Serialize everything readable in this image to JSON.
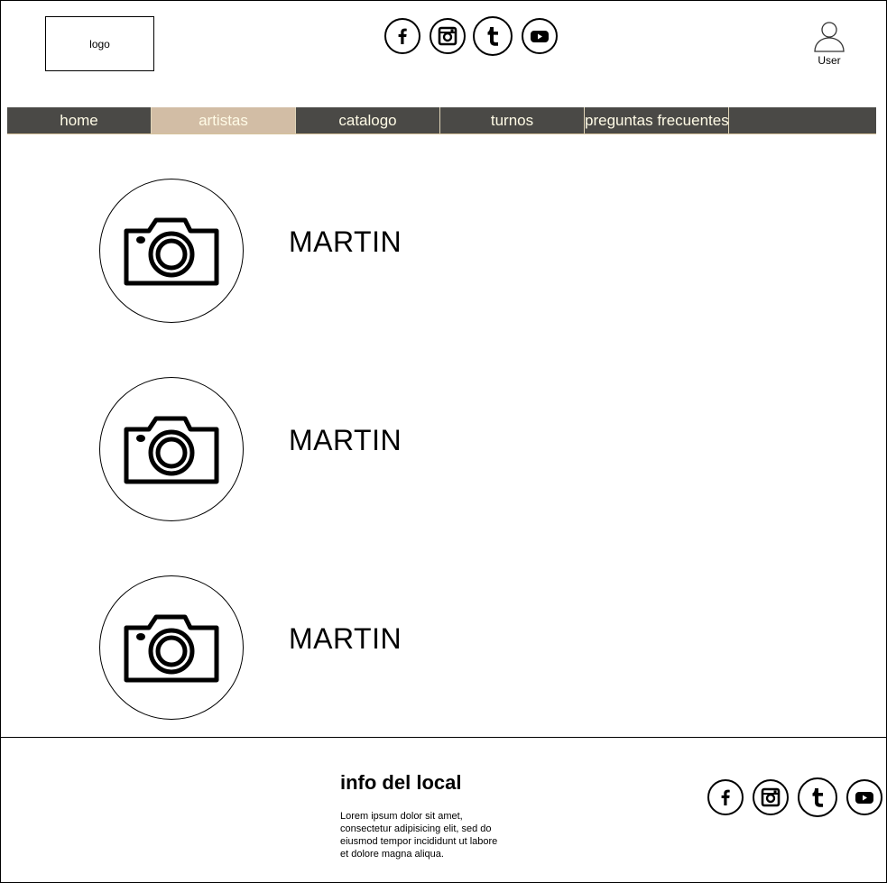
{
  "header": {
    "logo_text": "logo",
    "social_icons": [
      "facebook-icon",
      "instagram-icon",
      "tumblr-icon",
      "youtube-icon"
    ],
    "user_label": "User"
  },
  "nav": {
    "items": [
      {
        "label": "home",
        "active": false
      },
      {
        "label": "artistas",
        "active": true
      },
      {
        "label": "catalogo",
        "active": false
      },
      {
        "label": "turnos",
        "active": false
      },
      {
        "label": "preguntas frecuentes",
        "active": false
      }
    ],
    "colors": {
      "bar": "#4a4946",
      "active": "#d2bda5",
      "text": "#fffbe6"
    }
  },
  "artists": [
    {
      "name": "MARTIN",
      "photo_icon": "camera-icon"
    },
    {
      "name": "MARTIN",
      "photo_icon": "camera-icon"
    },
    {
      "name": "MARTIN",
      "photo_icon": "camera-icon"
    }
  ],
  "footer": {
    "title": "info del local",
    "text": "Lorem ipsum dolor sit amet, consectetur adipisicing elit, sed do eiusmod tempor incididunt ut labore et dolore magna aliqua.",
    "social_icons": [
      "facebook-icon",
      "instagram-icon",
      "tumblr-icon",
      "youtube-icon"
    ]
  }
}
